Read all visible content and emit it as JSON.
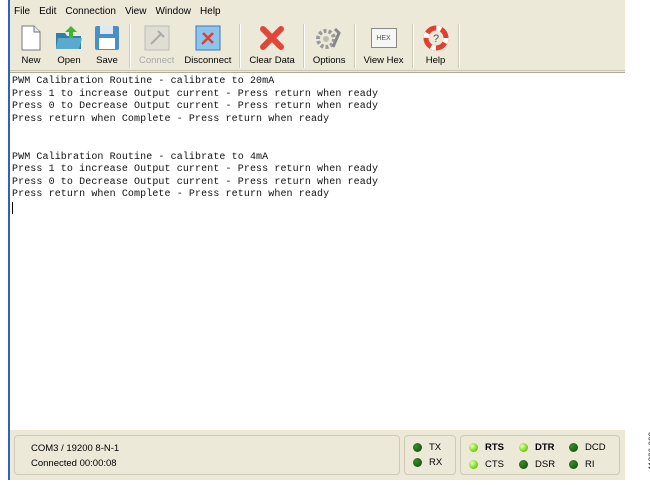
{
  "menu": [
    "File",
    "Edit",
    "Connection",
    "View",
    "Window",
    "Help"
  ],
  "toolbar": {
    "new": "New",
    "open": "Open",
    "save": "Save",
    "connect": "Connect",
    "disconnect": "Disconnect",
    "clear": "Clear Data",
    "options": "Options",
    "viewhex": "View Hex",
    "hex_icon_text": "HEX",
    "help": "Help"
  },
  "terminal": {
    "lines": [
      "PWM Calibration Routine - calibrate to 20mA",
      "Press 1 to increase Output current - Press return when ready",
      "Press 0 to Decrease Output current - Press return when ready",
      "Press return when Complete - Press return when ready",
      "",
      "",
      "PWM Calibration Routine - calibrate to 4mA",
      "Press 1 to increase Output current - Press return when ready",
      "Press 0 to Decrease Output current - Press return when ready",
      "Press return when Complete - Press return when ready"
    ]
  },
  "status": {
    "port": "COM3 / 19200 8-N-1",
    "connection": "Connected 00:00:08",
    "leds": {
      "tx": "TX",
      "rx": "RX",
      "rts": "RTS",
      "cts": "CTS",
      "dtr": "DTR",
      "dsr": "DSR",
      "dcd": "DCD",
      "ri": "RI"
    }
  },
  "figure_id": "11386-003"
}
